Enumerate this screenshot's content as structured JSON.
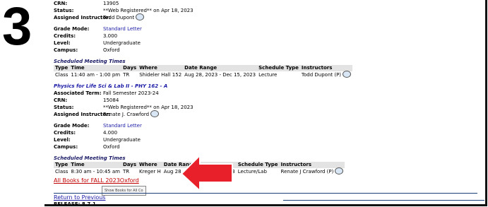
{
  "step_number": "3",
  "course1": {
    "fields_top": [
      {
        "label": "CRN:",
        "value": "13905"
      },
      {
        "label": "Status:",
        "value": "**Web Registered** on Apr 18, 2023"
      },
      {
        "label": "Assigned Instructor:",
        "value": "Todd Dupont"
      }
    ],
    "fields_mid": [
      {
        "label": "Grade Mode:",
        "value": "Standard Letter"
      },
      {
        "label": "Credits:",
        "value": "3.000"
      },
      {
        "label": "Level:",
        "value": "Undergraduate"
      },
      {
        "label": "Campus:",
        "value": "Oxford"
      }
    ],
    "meeting_title": "Scheduled Meeting Times",
    "meeting_headers": [
      "Type",
      "Time",
      "Days",
      "Where",
      "Date Range",
      "Schedule Type",
      "Instructors"
    ],
    "meeting_row": [
      "Class",
      "11:40 am - 1:00 pm",
      "TR",
      "Shideler Hall 152",
      "Aug 28, 2023 - Dec 15, 2023",
      "Lecture",
      "Todd Dupont (P)"
    ]
  },
  "course2": {
    "title": "Physics for Life Sci & Lab II - PHY 162 - A",
    "fields_top": [
      {
        "label": "Associated Term:",
        "value": "Fall Semester 2023-24"
      },
      {
        "label": "CRN:",
        "value": "15084"
      },
      {
        "label": "Status:",
        "value": "**Web Registered** on Apr 18, 2023"
      },
      {
        "label": "Assigned Instructor:",
        "value": "Renate J. Crawford"
      }
    ],
    "fields_mid": [
      {
        "label": "Grade Mode:",
        "value": "Standard Letter"
      },
      {
        "label": "Credits:",
        "value": "4.000"
      },
      {
        "label": "Level:",
        "value": "Undergraduate"
      },
      {
        "label": "Campus:",
        "value": "Oxford"
      }
    ],
    "meeting_title": "Scheduled Meeting Times",
    "meeting_headers": [
      "Type",
      "Time",
      "Days",
      "Where",
      "Date Range",
      "Schedule Type",
      "Instructors"
    ],
    "meeting_row": [
      "Class",
      "8:30 am - 10:45 am",
      "TR",
      "Kreger H",
      "Aug 28, 2023 - Dec 15, 2023",
      "Lecture/Lab",
      "Renate J Crawford (P)"
    ]
  },
  "books_link": "All Books for FALL 2023Oxford",
  "tooltip": "Show Books for All Co",
  "return_link": "Return to Previous",
  "release": "RELEASE: 8.7.1",
  "colors": {
    "arrow": "#e8202a",
    "link": "#1a1aa6",
    "books_link": "#c00000"
  }
}
